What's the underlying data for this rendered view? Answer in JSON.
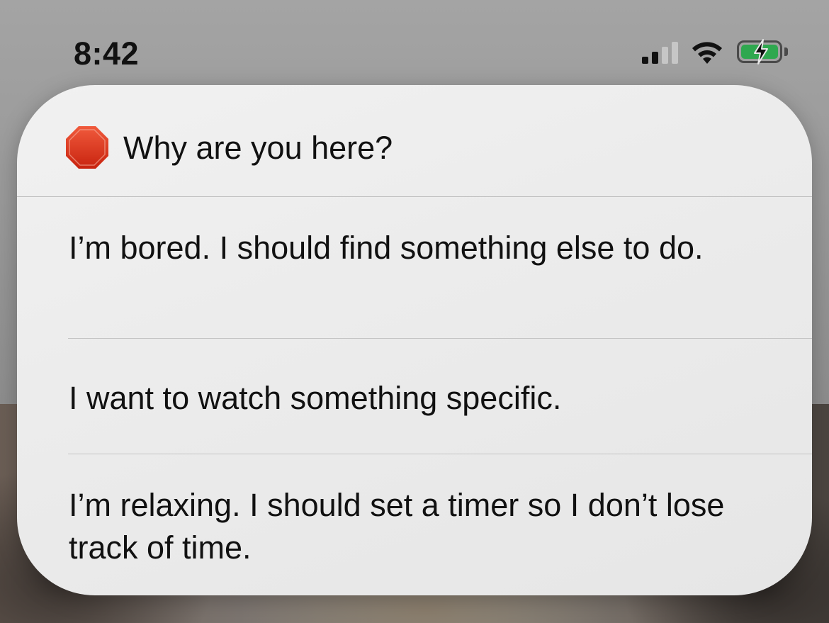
{
  "status_bar": {
    "time": "8:42",
    "signal_icon": "cellular-signal-icon",
    "wifi_icon": "wifi-icon",
    "battery_icon": "battery-charging-icon",
    "battery_color": "#2fa84f",
    "signal_bars_active": 2,
    "signal_bars_total": 4
  },
  "prompt": {
    "icon": "stop-sign-icon",
    "icon_color": "#d8301a",
    "title": "Why are you here?",
    "options": [
      {
        "label": "I’m bored. I should find something else to do."
      },
      {
        "label": "I want to watch something specific."
      },
      {
        "label": "I’m relaxing. I should set a timer so I don’t lose track of time."
      }
    ]
  }
}
